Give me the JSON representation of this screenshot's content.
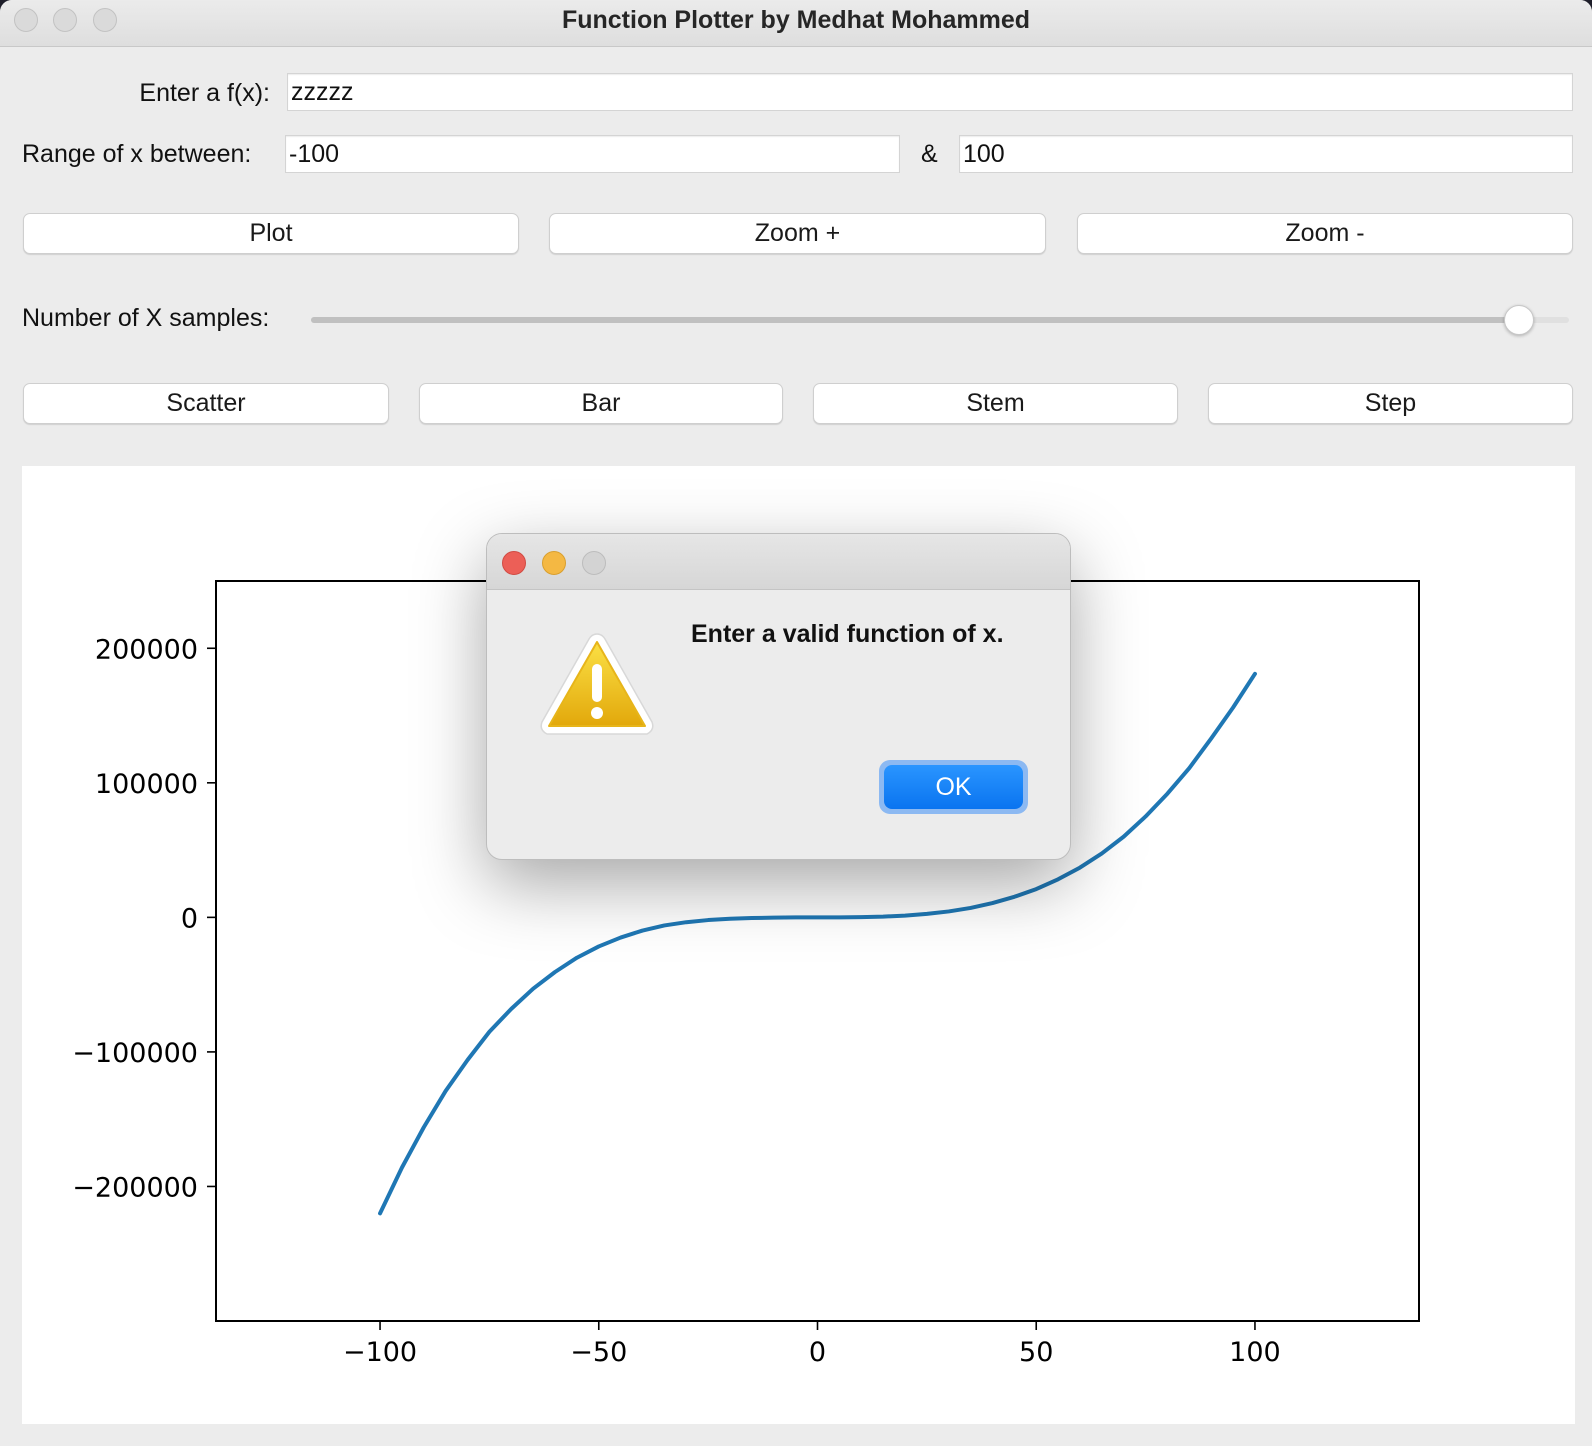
{
  "window": {
    "title": "Function Plotter by Medhat Mohammed"
  },
  "form": {
    "function_label": "Enter a f(x):",
    "function_value": "zzzzz",
    "range_label": "Range of x between:",
    "range_min": "-100",
    "range_separator": "&",
    "range_max": "100",
    "samples_label": "Number of X samples:",
    "samples_level": 0.96
  },
  "buttons": {
    "plot": "Plot",
    "zoom_in": "Zoom +",
    "zoom_out": "Zoom -",
    "scatter": "Scatter",
    "bar": "Bar",
    "stem": "Stem",
    "step": "Step"
  },
  "dialog": {
    "message": "Enter a valid function of x.",
    "ok_label": "OK",
    "icon": "warning-icon"
  },
  "chart_data": {
    "type": "line",
    "x": [
      -100,
      -95,
      -90,
      -85,
      -80,
      -75,
      -70,
      -65,
      -60,
      -55,
      -50,
      -45,
      -40,
      -35,
      -30,
      -25,
      -20,
      -15,
      -10,
      -5,
      0,
      5,
      10,
      15,
      20,
      25,
      30,
      35,
      40,
      45,
      50,
      55,
      60,
      65,
      70,
      75,
      80,
      85,
      90,
      95,
      100
    ],
    "series": [
      {
        "values": [
          -220000,
          -186000,
          -156000,
          -129000,
          -106000,
          -85000,
          -68000,
          -53000,
          -40600,
          -30000,
          -21600,
          -15000,
          -9800,
          -6000,
          -3600,
          -2000,
          -1000,
          -500,
          -200,
          -40,
          0,
          30,
          180,
          560,
          1300,
          2600,
          4400,
          7000,
          10600,
          15300,
          21000,
          28300,
          37000,
          47500,
          60000,
          75000,
          92000,
          111000,
          133000,
          156000,
          181000
        ],
        "color": "#1f77b4"
      }
    ],
    "xticks": [
      "−100",
      "−50",
      "0",
      "50",
      "100"
    ],
    "yticks": [
      "200000",
      "100000",
      "0",
      "−100000",
      "−200000"
    ],
    "xlim": [
      -137.5,
      137.5
    ],
    "ylim": [
      -300000,
      250000
    ],
    "grid": false
  }
}
